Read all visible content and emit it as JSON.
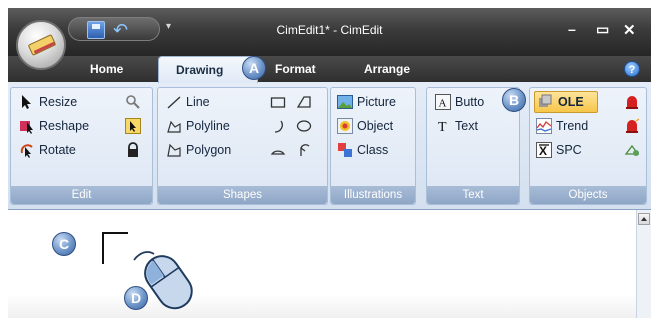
{
  "window": {
    "title": "CimEdit1* - CimEdit",
    "controls": {
      "minimize": "–",
      "maximize": "▭",
      "close": "✕"
    }
  },
  "quick_access": {
    "more": "▾"
  },
  "tabs": [
    {
      "label": "Home",
      "active": false
    },
    {
      "label": "Drawing",
      "active": true
    },
    {
      "label": "Format",
      "active": false
    },
    {
      "label": "Arrange",
      "active": false
    }
  ],
  "help": "?",
  "groups": {
    "edit": {
      "label": "Edit",
      "items": [
        "Resize",
        "Reshape",
        "Rotate"
      ]
    },
    "shapes": {
      "label": "Shapes",
      "items": [
        "Line",
        "Polyline",
        "Polygon"
      ]
    },
    "illustrations": {
      "label": "Illustrations",
      "items": [
        "Picture",
        "Object",
        "Class"
      ]
    },
    "text": {
      "label": "Text",
      "items": [
        "Butto",
        "Text"
      ]
    },
    "objects": {
      "label": "Objects",
      "items": [
        "OLE",
        "Trend",
        "SPC"
      ]
    }
  },
  "callouts": {
    "a": "A",
    "b": "B",
    "c": "C",
    "d": "D"
  },
  "colors": {
    "ribbon_bg": "#dce6f3",
    "titlebar": "#3b3b3b",
    "callout": "#6e95c9",
    "ole_highlight": "#fbd56a"
  }
}
